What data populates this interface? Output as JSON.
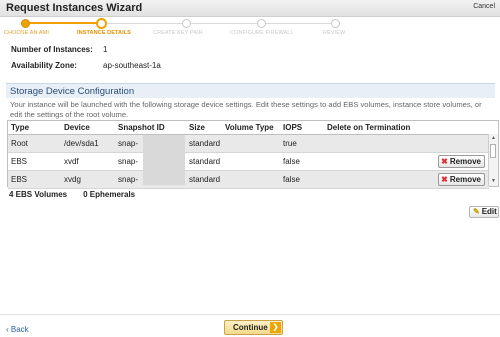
{
  "window": {
    "title": "Request Instances Wizard",
    "cancel_label": "Cancel"
  },
  "steps": [
    {
      "label": "CHOOSE AN AMI",
      "state": "done"
    },
    {
      "label": "INSTANCE DETAILS",
      "state": "current"
    },
    {
      "label": "CREATE KEY PAIR",
      "state": "todo"
    },
    {
      "label": "CONFIGURE FIREWALL",
      "state": "todo"
    },
    {
      "label": "REVIEW",
      "state": "todo"
    }
  ],
  "summary": {
    "instances_label": "Number of Instances:",
    "instances_value": "1",
    "zone_label": "Availability Zone:",
    "zone_value": "ap-southeast-1a"
  },
  "storage": {
    "heading": "Storage Device Configuration",
    "description": "Your instance will be launched with the following storage device settings. Edit these settings to add EBS volumes, instance store volumes, or edit the settings of the root volume.",
    "columns": [
      "Type",
      "Device",
      "Snapshot ID",
      "Size",
      "Volume Type",
      "IOPS",
      "Delete on Termination"
    ],
    "rows": [
      {
        "type": "Root",
        "device": "/dev/sda1",
        "snapshot": "snap-",
        "size": "",
        "volume_type": "standard",
        "iops": "",
        "delete": "true",
        "removable": false
      },
      {
        "type": "EBS",
        "device": "xvdf",
        "snapshot": "snap-",
        "size": "",
        "volume_type": "standard",
        "iops": "",
        "delete": "false",
        "removable": true
      },
      {
        "type": "EBS",
        "device": "xvdg",
        "snapshot": "snap-",
        "size": "",
        "volume_type": "standard",
        "iops": "",
        "delete": "false",
        "removable": true
      }
    ],
    "remove_label": "Remove",
    "ebs_count": "4 EBS Volumes",
    "ephemeral_count": "0 Ephemerals",
    "edit_label": "Edit"
  },
  "footer": {
    "back_label": "Back",
    "continue_label": "Continue"
  },
  "colors": {
    "accent": "#f1a200",
    "link": "#2b5ea7",
    "section_bg": "#e9eff6"
  }
}
